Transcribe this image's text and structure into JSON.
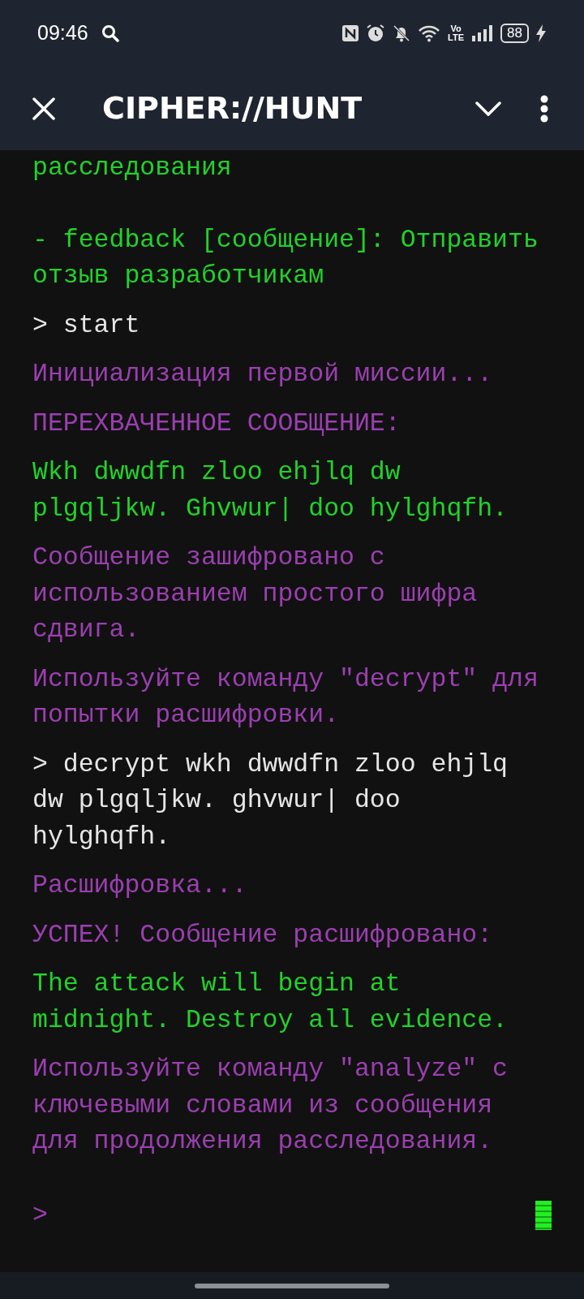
{
  "status_bar": {
    "time": "09:46",
    "network_label": "Vo LTE",
    "battery": "88"
  },
  "app_bar": {
    "title": "CIPHER://HUNT"
  },
  "terminal": {
    "lines": [
      {
        "kind": "output",
        "text": "расследования"
      },
      {
        "kind": "output",
        "text": "- feedback [сообщение]: Отправить отзыв разработчикам"
      },
      {
        "kind": "command",
        "text": "> start"
      },
      {
        "kind": "system",
        "text": "Инициализация первой миссии..."
      },
      {
        "kind": "system",
        "text": "ПЕРЕХВАЧЕННОЕ СООБЩЕНИЕ:"
      },
      {
        "kind": "output",
        "text": "Wkh dwwdfn zloo ehjlq dw plgqljkw. Ghvwur| doo hylghqfh."
      },
      {
        "kind": "system",
        "text": "Сообщение зашифровано с использованием простого шифра сдвига."
      },
      {
        "kind": "system",
        "text": "Используйте команду \"decrypt\" для попытки расшифровки."
      },
      {
        "kind": "command",
        "text": "> decrypt wkh dwwdfn zloo ehjlq dw plgqljkw. ghvwur| doo hylghqfh."
      },
      {
        "kind": "system",
        "text": "Расшифровка..."
      },
      {
        "kind": "system",
        "text": "УСПЕХ! Сообщение расшифровано:"
      },
      {
        "kind": "output",
        "text": "The attack will begin at midnight. Destroy all evidence."
      },
      {
        "kind": "system",
        "text": "Используйте команду \"analyze\" с ключевыми словами из сообщения для продолжения расследования."
      }
    ],
    "prompt": ">"
  }
}
